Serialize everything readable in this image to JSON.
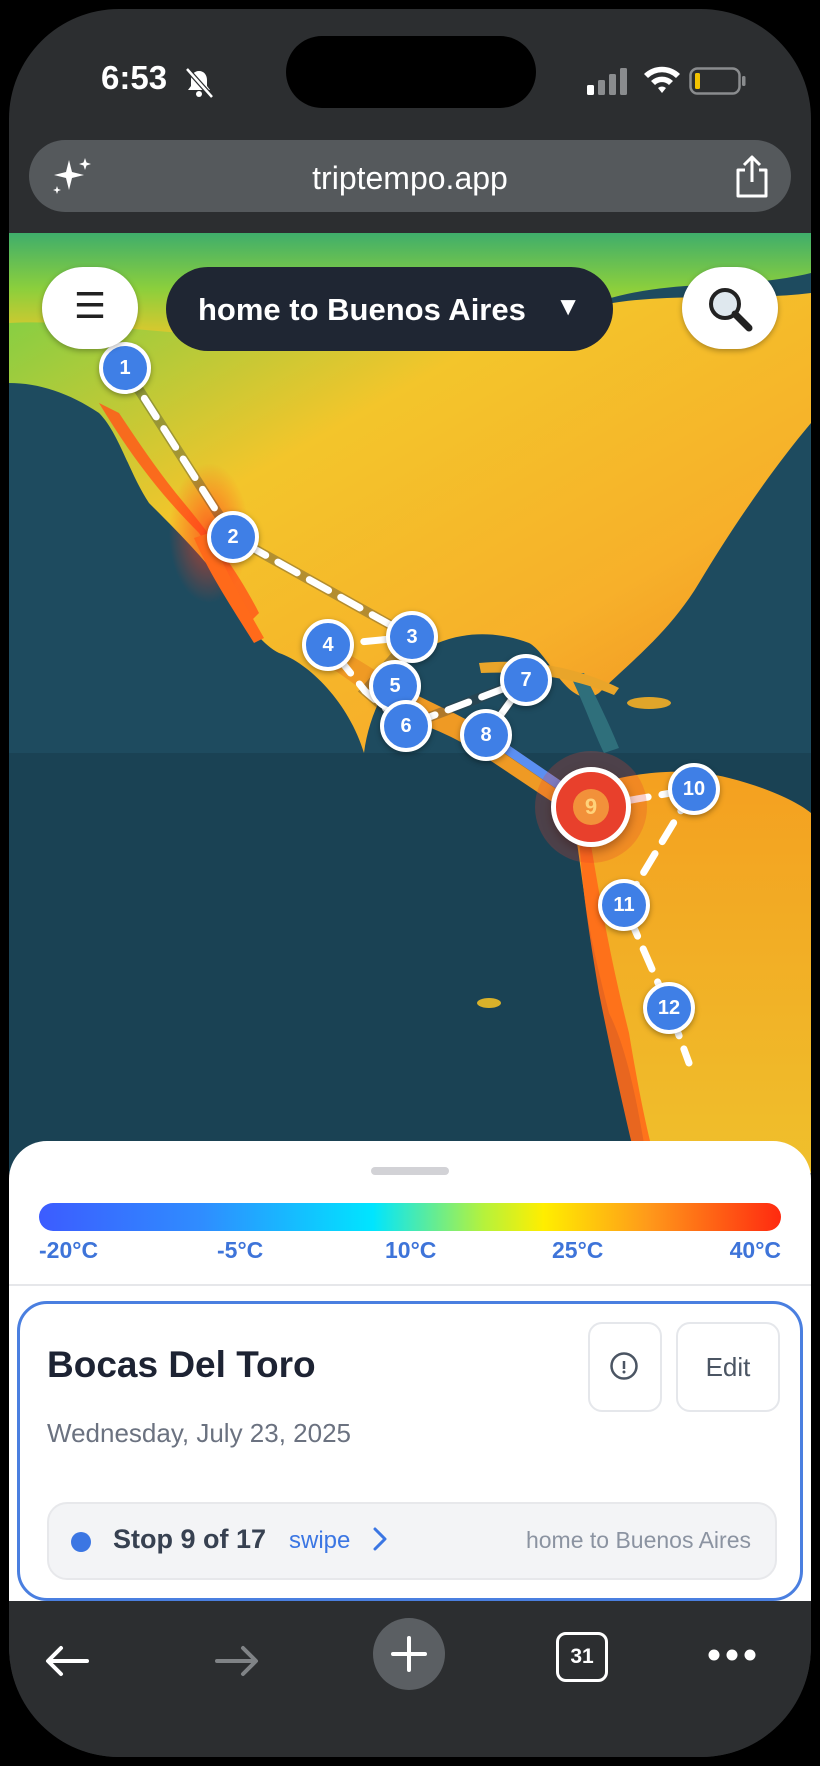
{
  "status_bar": {
    "time": "6:53"
  },
  "browser": {
    "url": "triptempo.app",
    "tab_count": "31"
  },
  "map": {
    "trip_selector": {
      "label": "home to Buenos Aires",
      "arrow": "▼"
    },
    "menu_icon": "☰",
    "stops": [
      "1",
      "2",
      "3",
      "4",
      "5",
      "6",
      "7",
      "8",
      "9",
      "10",
      "11",
      "12"
    ],
    "selected_stop": "9"
  },
  "temperature_scale": {
    "labels": [
      "-20°C",
      "-5°C",
      "10°C",
      "25°C",
      "40°C"
    ],
    "colors": [
      "#3c5cff",
      "#2f8dff",
      "#00e5ff",
      "#ffee00",
      "#ff2a10"
    ]
  },
  "stop_card": {
    "title": "Bocas Del Toro",
    "date": "Wednesday, July 23, 2025",
    "edit_label": "Edit",
    "stop_text": "Stop 9 of 17",
    "swipe_label": "swipe",
    "trip_name": "home to Buenos Aires"
  },
  "colors": {
    "accent": "#3b76e3",
    "pin": "#3f7fe6",
    "selected_pin": "#e8402c"
  }
}
